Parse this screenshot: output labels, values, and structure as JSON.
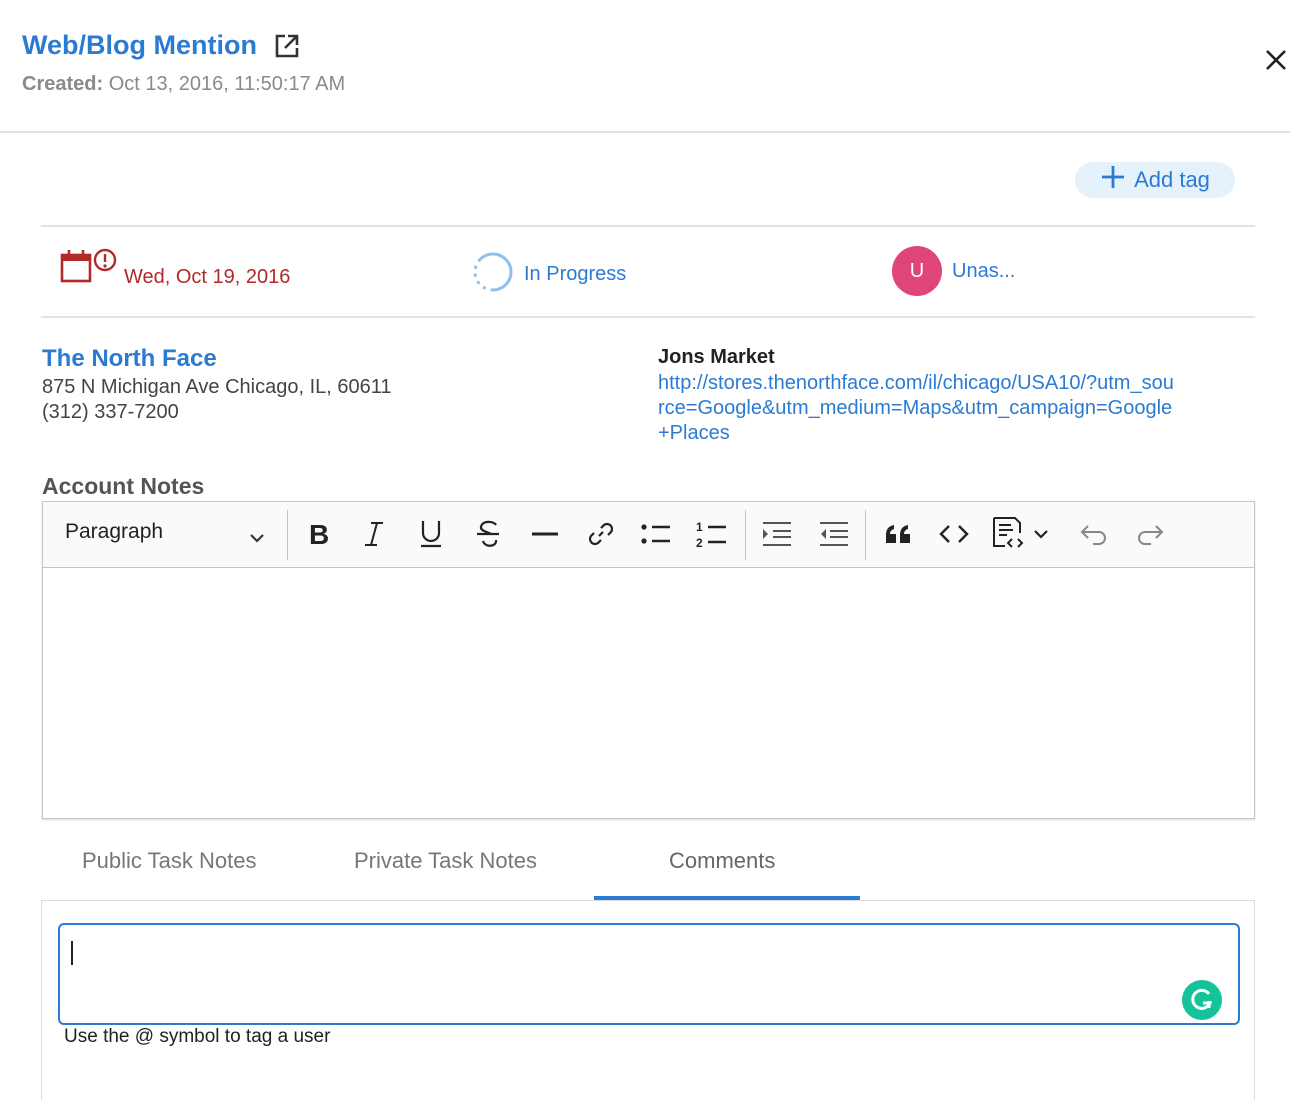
{
  "header": {
    "title": "Web/Blog Mention",
    "created_label": "Created:",
    "created_value": "Oct 13, 2016, 11:50:17 AM"
  },
  "tags": {
    "add_label": "Add tag"
  },
  "status": {
    "due_date": "Wed, Oct 19, 2016",
    "progress": "In Progress",
    "assignee_initial": "U",
    "assignee_name": "Unas..."
  },
  "account": {
    "name": "The North Face",
    "address": "875 N Michigan Ave Chicago, IL, 60611",
    "phone": "(312) 337-7200"
  },
  "store": {
    "name": "Jons Market",
    "url": "http://stores.thenorthface.com/il/chicago/USA10/?utm_source=Google&utm_medium=Maps&utm_campaign=Google+Places"
  },
  "notes": {
    "label": "Account Notes",
    "block_format": "Paragraph"
  },
  "tabs": [
    {
      "label": "Public Task Notes"
    },
    {
      "label": "Private Task Notes"
    },
    {
      "label": "Comments"
    }
  ],
  "active_tab": "Comments",
  "comment": {
    "value": "",
    "hint": "Use the @ symbol to tag a user"
  },
  "colors": {
    "accent": "#2b7bd3",
    "due_red": "#b02a2a",
    "avatar_pink": "#e0457a",
    "grammarly_green": "#15c39a"
  }
}
